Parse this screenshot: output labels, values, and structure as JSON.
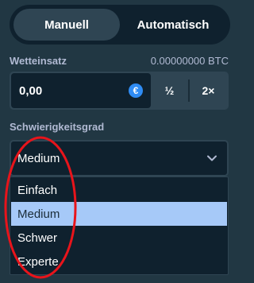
{
  "mode_toggle": {
    "manual_label": "Manuell",
    "auto_label": "Automatisch",
    "active": "manual"
  },
  "bet": {
    "label": "Wetteinsatz",
    "balance": "0.00000000 BTC",
    "value": "0,00",
    "currency_icon": "€",
    "half_label": "½",
    "double_label": "2×"
  },
  "difficulty": {
    "label": "Schwierigkeitsgrad",
    "selected": "Medium",
    "options": [
      "Einfach",
      "Medium",
      "Schwer",
      "Experte"
    ],
    "selected_index": 1
  },
  "colors": {
    "background": "#213743",
    "input_bg": "#0f212e",
    "border": "#2f4553",
    "label": "#b1bad3",
    "selected_option": "#a6c9f8",
    "euro_badge": "#2f8cf4",
    "annotation": "#e8141b"
  }
}
